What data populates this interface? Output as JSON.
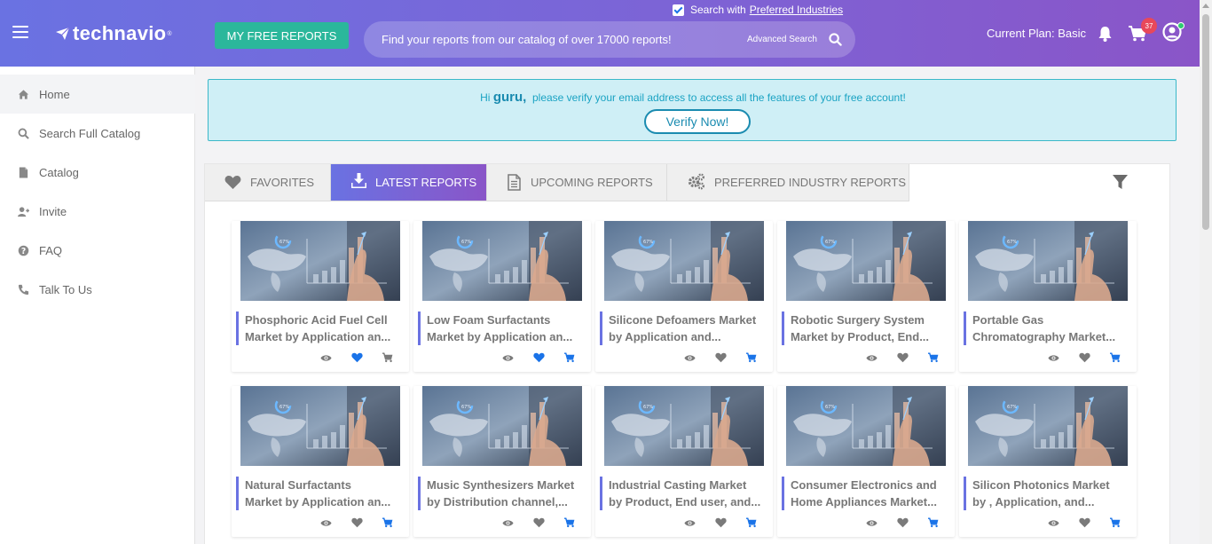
{
  "header": {
    "logo": "technavio",
    "logo_mark": "®",
    "free_reports_button": "MY FREE REPORTS",
    "search_with_label": "Search with",
    "preferred_industries_link": "Preferred Industries",
    "search_placeholder": "Find your reports from our catalog of over 17000 reports!",
    "advanced_search": "Advanced Search",
    "current_plan": "Current Plan: Basic",
    "cart_count": "37"
  },
  "sidebar": {
    "items": [
      {
        "label": "Home",
        "icon": "home-icon"
      },
      {
        "label": "Search Full Catalog",
        "icon": "search-icon"
      },
      {
        "label": "Catalog",
        "icon": "document-icon"
      },
      {
        "label": "Invite",
        "icon": "user-plus-icon"
      },
      {
        "label": "FAQ",
        "icon": "question-icon"
      },
      {
        "label": "Talk To Us",
        "icon": "phone-icon"
      }
    ]
  },
  "verify": {
    "hi": "Hi",
    "user": "guru,",
    "message": "please verify your email address to access all the features of your free account!",
    "button": "Verify Now!"
  },
  "tabs": [
    {
      "label": "FAVORITES",
      "icon": "heart-icon"
    },
    {
      "label": "LATEST REPORTS",
      "icon": "download-icon"
    },
    {
      "label": "UPCOMING REPORTS",
      "icon": "file-icon"
    },
    {
      "label": "PREFERRED INDUSTRY REPORTS",
      "icon": "gears-icon"
    }
  ],
  "reports": [
    {
      "line1": "Phosphoric Acid Fuel Cell",
      "line2": "Market by Application an...",
      "favorited": true
    },
    {
      "line1": "Low Foam Surfactants",
      "line2": "Market by Application an...",
      "favorited": true
    },
    {
      "line1": "Silicone Defoamers Market",
      "line2": "by Application and...",
      "favorited": false
    },
    {
      "line1": "Robotic Surgery System",
      "line2": "Market by Product, End...",
      "favorited": false
    },
    {
      "line1": "Portable Gas",
      "line2": "Chromatography Market...",
      "favorited": false
    },
    {
      "line1": "Natural Surfactants",
      "line2": "Market by Application an...",
      "favorited": false
    },
    {
      "line1": "Music Synthesizers Market",
      "line2": "by Distribution channel,...",
      "favorited": false
    },
    {
      "line1": "Industrial Casting Market",
      "line2": "by Product, End user, and...",
      "favorited": false
    },
    {
      "line1": "Consumer Electronics and",
      "line2": "Home Appliances Market...",
      "favorited": false
    },
    {
      "line1": "Silicon Photonics Market",
      "line2": "by , Application, and...",
      "favorited": false
    }
  ],
  "colors": {
    "accent": "#6a72e2",
    "teal": "#2bb79b",
    "heart_active": "#1a73e8",
    "icon_gray": "#7a7a7a"
  }
}
